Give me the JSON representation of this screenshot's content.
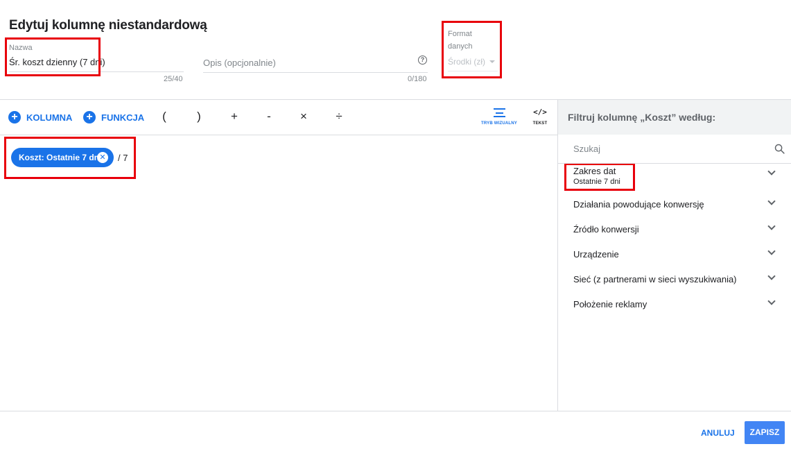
{
  "dialog": {
    "title": "Edytuj kolumnę niestandardową"
  },
  "name_field": {
    "label": "Nazwa",
    "value": "Śr. koszt dzienny (7 dni)",
    "counter": "25/40"
  },
  "description_field": {
    "placeholder": "Opis (opcjonalnie)",
    "help_icon": "?",
    "counter": "0/180"
  },
  "format_field": {
    "label": "Format danych",
    "value": "Środki (zł)"
  },
  "toolbar": {
    "column_label": "KOLUMNA",
    "function_label": "FUNKCJA",
    "operators": [
      "(",
      ")",
      "+",
      "-",
      "×",
      "÷"
    ],
    "visual_mode_label": "TRYB WIZUALNY",
    "text_mode_label": "TEKST",
    "text_mode_icon": "</>"
  },
  "formula": {
    "chip_label": "Koszt: Ostatnie 7 dni",
    "chip_remove": "✕",
    "suffix": "/ 7"
  },
  "filter_panel": {
    "title": "Filtruj kolumnę „Koszt” według:",
    "search_placeholder": "Szukaj",
    "items": [
      {
        "label": "Zakres dat",
        "sub": "Ostatnie 7 dni"
      },
      {
        "label": "Działania powodujące konwersję"
      },
      {
        "label": "Źródło konwersji"
      },
      {
        "label": "Urządzenie"
      },
      {
        "label": "Sieć (z partnerami w sieci wyszukiwania)"
      },
      {
        "label": "Położenie reklamy"
      }
    ]
  },
  "footer": {
    "cancel_label": "ANULUJ",
    "save_label": "ZAPISZ"
  },
  "colors": {
    "accent": "#1a73e8",
    "highlight_box": "#e8000b",
    "save_button": "#4285f4"
  }
}
